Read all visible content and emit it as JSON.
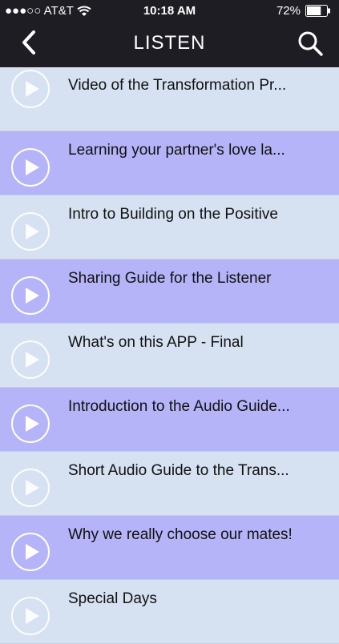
{
  "status_bar": {
    "carrier": "●●●○○ AT&T",
    "time": "10:18 AM",
    "battery": "72%",
    "battery_level": 0.72
  },
  "nav": {
    "title": "LISTEN",
    "back_icon": "chevron-left-icon",
    "search_icon": "search-icon"
  },
  "colors": {
    "header_bg": "#1e1d23",
    "row_light": "#d6e2f2",
    "row_purple": "#b6b4f8",
    "play_circle": "#ffffff"
  },
  "items": [
    {
      "title": "Video of the Transformation Pr...",
      "style": "light"
    },
    {
      "title": "Learning your partner's love la...",
      "style": "purple"
    },
    {
      "title": "Intro to Building on the Positive",
      "style": "light"
    },
    {
      "title": "Sharing Guide for the Listener",
      "style": "purple"
    },
    {
      "title": "What's on this APP - Final",
      "style": "light"
    },
    {
      "title": "Introduction to the Audio Guide...",
      "style": "purple"
    },
    {
      "title": "Short Audio Guide to the Trans...",
      "style": "light"
    },
    {
      "title": "Why we really choose our mates!",
      "style": "purple"
    },
    {
      "title": "Special Days",
      "style": "light"
    }
  ]
}
